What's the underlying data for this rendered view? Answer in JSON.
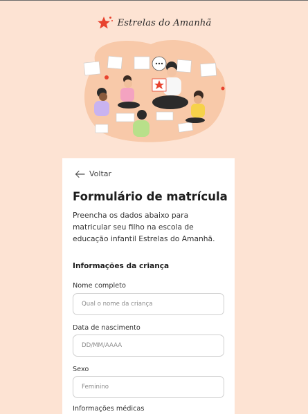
{
  "brand": {
    "name": "Estrelas do Amanhã",
    "icon": "star-logo-icon",
    "accent": "#e8432f"
  },
  "colors": {
    "background": "#fde3d3",
    "card": "#ffffff",
    "blob": "#f8c9a9"
  },
  "form": {
    "back_label": "Voltar",
    "title": "Formulário de matrícula",
    "subtitle": "Preencha os dados abaixo para matricular seu filho na escola de educação infantil Estrelas do Amanhã.",
    "section_title": "Informações da criança",
    "fields": [
      {
        "label": "Nome completo",
        "placeholder": "Qual o nome da criança",
        "value": ""
      },
      {
        "label": "Data de nascimento",
        "placeholder": "DD/MM/AAAA",
        "value": ""
      },
      {
        "label": "Sexo",
        "placeholder": "Feminino",
        "value": ""
      },
      {
        "label": "Informações médicas"
      }
    ]
  }
}
